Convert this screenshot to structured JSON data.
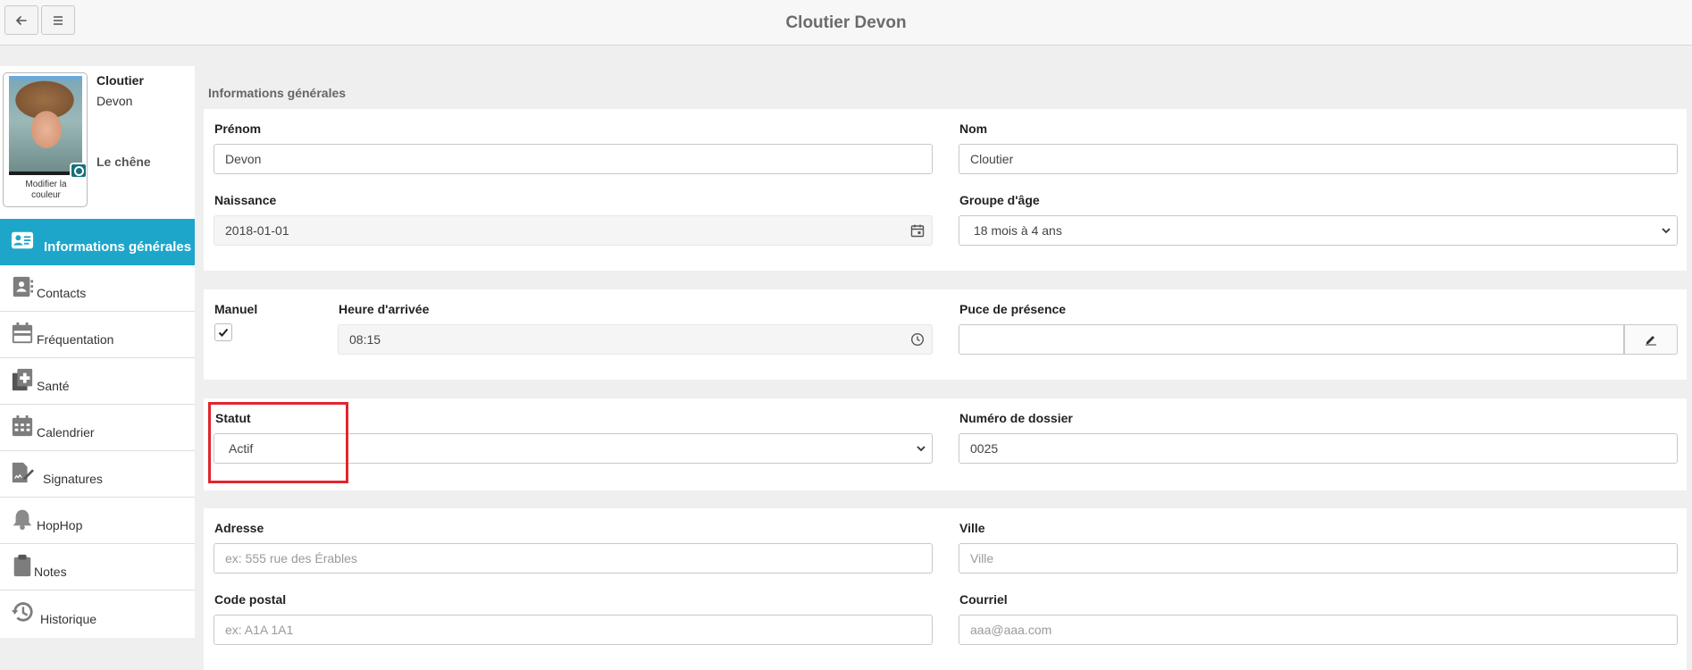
{
  "header": {
    "title": "Cloutier Devon",
    "back_icon": "arrow-left-icon",
    "menu_icon": "hamburger-icon"
  },
  "profile": {
    "last_name": "Cloutier",
    "first_name": "Devon",
    "group": "Le chêne",
    "photo_caption_line1": "Modifier la",
    "photo_caption_line2": "couleur"
  },
  "sidebar": {
    "items": [
      {
        "label": "Informations générales",
        "icon": "id-card-icon",
        "active": true
      },
      {
        "label": "Contacts",
        "icon": "contact-book-icon"
      },
      {
        "label": "Fréquentation",
        "icon": "calendar-icon"
      },
      {
        "label": "Santé",
        "icon": "medical-file-icon"
      },
      {
        "label": "Calendrier",
        "icon": "calendar-grid-icon"
      },
      {
        "label": "Signatures",
        "icon": "signature-icon"
      },
      {
        "label": "HopHop",
        "icon": "bell-icon"
      },
      {
        "label": "Notes",
        "icon": "clipboard-icon"
      },
      {
        "label": "Historique",
        "icon": "history-icon"
      }
    ]
  },
  "main": {
    "section_title": "Informations générales",
    "prenom": {
      "label": "Prénom",
      "value": "Devon"
    },
    "nom": {
      "label": "Nom",
      "value": "Cloutier"
    },
    "naissance": {
      "label": "Naissance",
      "value": "2018-01-01"
    },
    "groupe_age": {
      "label": "Groupe d'âge",
      "value": "18 mois à 4 ans"
    },
    "manuel": {
      "label": "Manuel",
      "checked": true
    },
    "heure_arrivee": {
      "label": "Heure d'arrivée",
      "value": "08:15"
    },
    "puce_presence": {
      "label": "Puce de présence",
      "value": ""
    },
    "statut": {
      "label": "Statut",
      "value": "Actif"
    },
    "numero_dossier": {
      "label": "Numéro de dossier",
      "value": "0025"
    },
    "adresse": {
      "label": "Adresse",
      "placeholder": "ex: 555 rue des Érables"
    },
    "ville": {
      "label": "Ville",
      "placeholder": "Ville"
    },
    "code_postal": {
      "label": "Code postal",
      "placeholder": "ex: A1A 1A1"
    },
    "courriel": {
      "label": "Courriel",
      "placeholder": "aaa@aaa.com"
    }
  },
  "colors": {
    "accent": "#1da6c9",
    "highlight": "#e0262d"
  }
}
